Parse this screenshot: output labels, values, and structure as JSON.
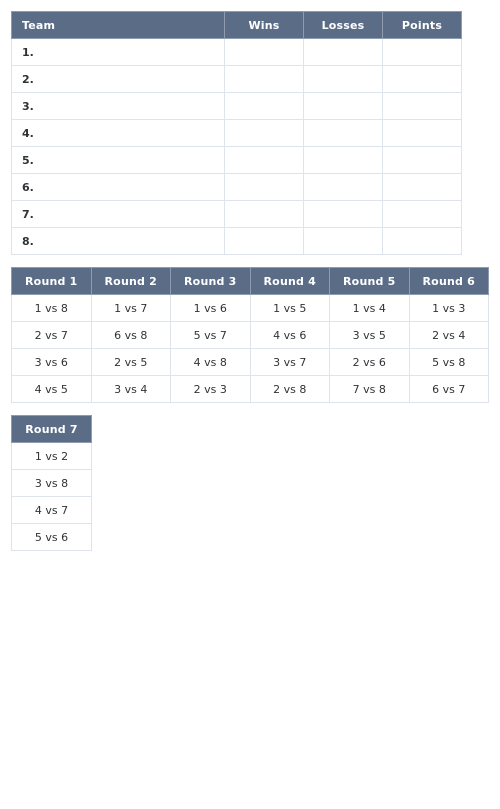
{
  "theme": {
    "header_bg": "#5b6c87",
    "header_text": "#ffffff",
    "border": "#dfe4ec",
    "header_border": "#8e9bb0",
    "body_text": "#2f3337",
    "page_bg": "#ffffff"
  },
  "standings": {
    "columns": [
      "Team",
      "Wins",
      "Losses",
      "Points"
    ],
    "rows": [
      {
        "team": "1.",
        "wins": "",
        "losses": "",
        "points": ""
      },
      {
        "team": "2.",
        "wins": "",
        "losses": "",
        "points": ""
      },
      {
        "team": "3.",
        "wins": "",
        "losses": "",
        "points": ""
      },
      {
        "team": "4.",
        "wins": "",
        "losses": "",
        "points": ""
      },
      {
        "team": "5.",
        "wins": "",
        "losses": "",
        "points": ""
      },
      {
        "team": "6.",
        "wins": "",
        "losses": "",
        "points": ""
      },
      {
        "team": "7.",
        "wins": "",
        "losses": "",
        "points": ""
      },
      {
        "team": "8.",
        "wins": "",
        "losses": "",
        "points": ""
      }
    ]
  },
  "rounds_block_1": {
    "columns": [
      "Round 1",
      "Round 2",
      "Round 3",
      "Round 4",
      "Round 5",
      "Round 6"
    ],
    "rows": [
      [
        "1 vs 8",
        "1 vs 7",
        "1 vs 6",
        "1 vs 5",
        "1 vs 4",
        "1 vs 3"
      ],
      [
        "2 vs 7",
        "6 vs 8",
        "5 vs 7",
        "4 vs 6",
        "3 vs 5",
        "2 vs 4"
      ],
      [
        "3 vs 6",
        "2 vs 5",
        "4 vs 8",
        "3 vs 7",
        "2 vs 6",
        "5 vs 8"
      ],
      [
        "4 vs 5",
        "3 vs 4",
        "2 vs 3",
        "2 vs 8",
        "7 vs 8",
        "6 vs 7"
      ]
    ]
  },
  "rounds_block_2": {
    "columns": [
      "Round 7"
    ],
    "rows": [
      [
        "1 vs 2"
      ],
      [
        "3 vs 8"
      ],
      [
        "4 vs 7"
      ],
      [
        "5 vs 6"
      ]
    ]
  }
}
